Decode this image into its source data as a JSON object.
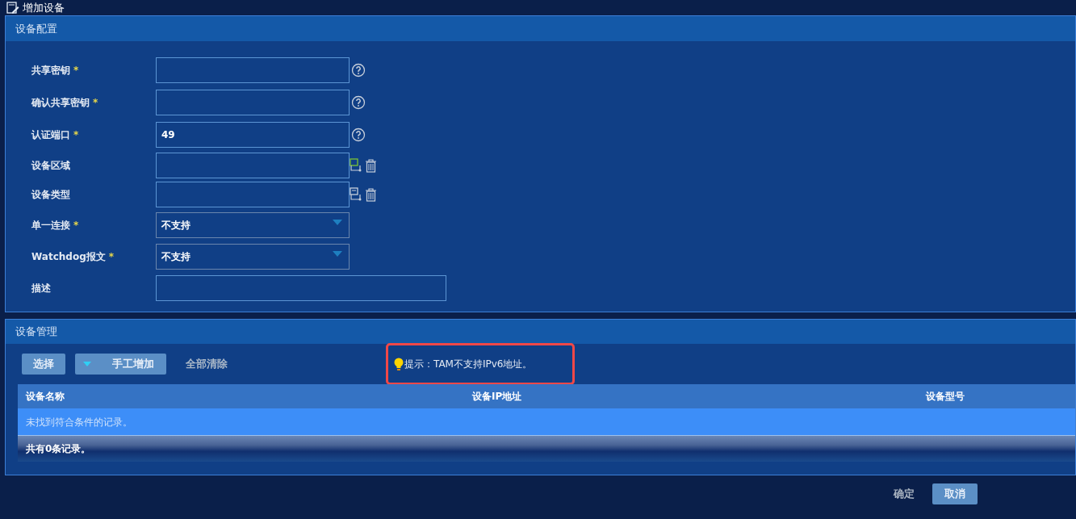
{
  "window": {
    "title": "增加设备"
  },
  "config": {
    "title": "设备配置",
    "fields": [
      {
        "label": "共享密钥",
        "required_mark": "*",
        "kind": "text",
        "actions": [
          {
            "kind": "help"
          }
        ]
      },
      {
        "label": "确认共享密钥",
        "required_mark": "*",
        "kind": "text",
        "actions": [
          {
            "kind": "help"
          }
        ]
      },
      {
        "label": "认证端口",
        "required_mark": "*",
        "kind": "text",
        "value": "49",
        "actions": [
          {
            "kind": "help"
          }
        ]
      },
      {
        "label": "设备区域",
        "kind": "text",
        "actions": [
          {
            "kind": "pick-green"
          },
          {
            "kind": "delete"
          }
        ]
      },
      {
        "label": "设备类型",
        "kind": "text",
        "actions": [
          {
            "kind": "pick"
          },
          {
            "kind": "delete"
          }
        ]
      },
      {
        "label": "单一连接",
        "required_mark": "*",
        "kind": "select",
        "value": "不支持"
      },
      {
        "label": "Watchdog报文",
        "required_mark": "*",
        "kind": "select",
        "value": "不支持"
      },
      {
        "label": "描述",
        "kind": "wide"
      }
    ]
  },
  "management": {
    "title": "设备管理",
    "buttons": [
      {
        "label": "选择",
        "kind": "plain"
      },
      {
        "label": "手工增加",
        "kind": "dropdown"
      },
      {
        "label": "全部清除",
        "kind": "link"
      }
    ],
    "hint": "提示：TAM不支持IPv6地址。",
    "table": {
      "columns": [
        "设备名称",
        "设备IP地址",
        "设备型号"
      ],
      "empty_message": "未找到符合条件的记录。",
      "footer": "共有0条记录。"
    }
  },
  "footer_buttons": [
    {
      "label": "确定",
      "kind": "link"
    },
    {
      "label": "取消",
      "kind": "primary"
    }
  ]
}
